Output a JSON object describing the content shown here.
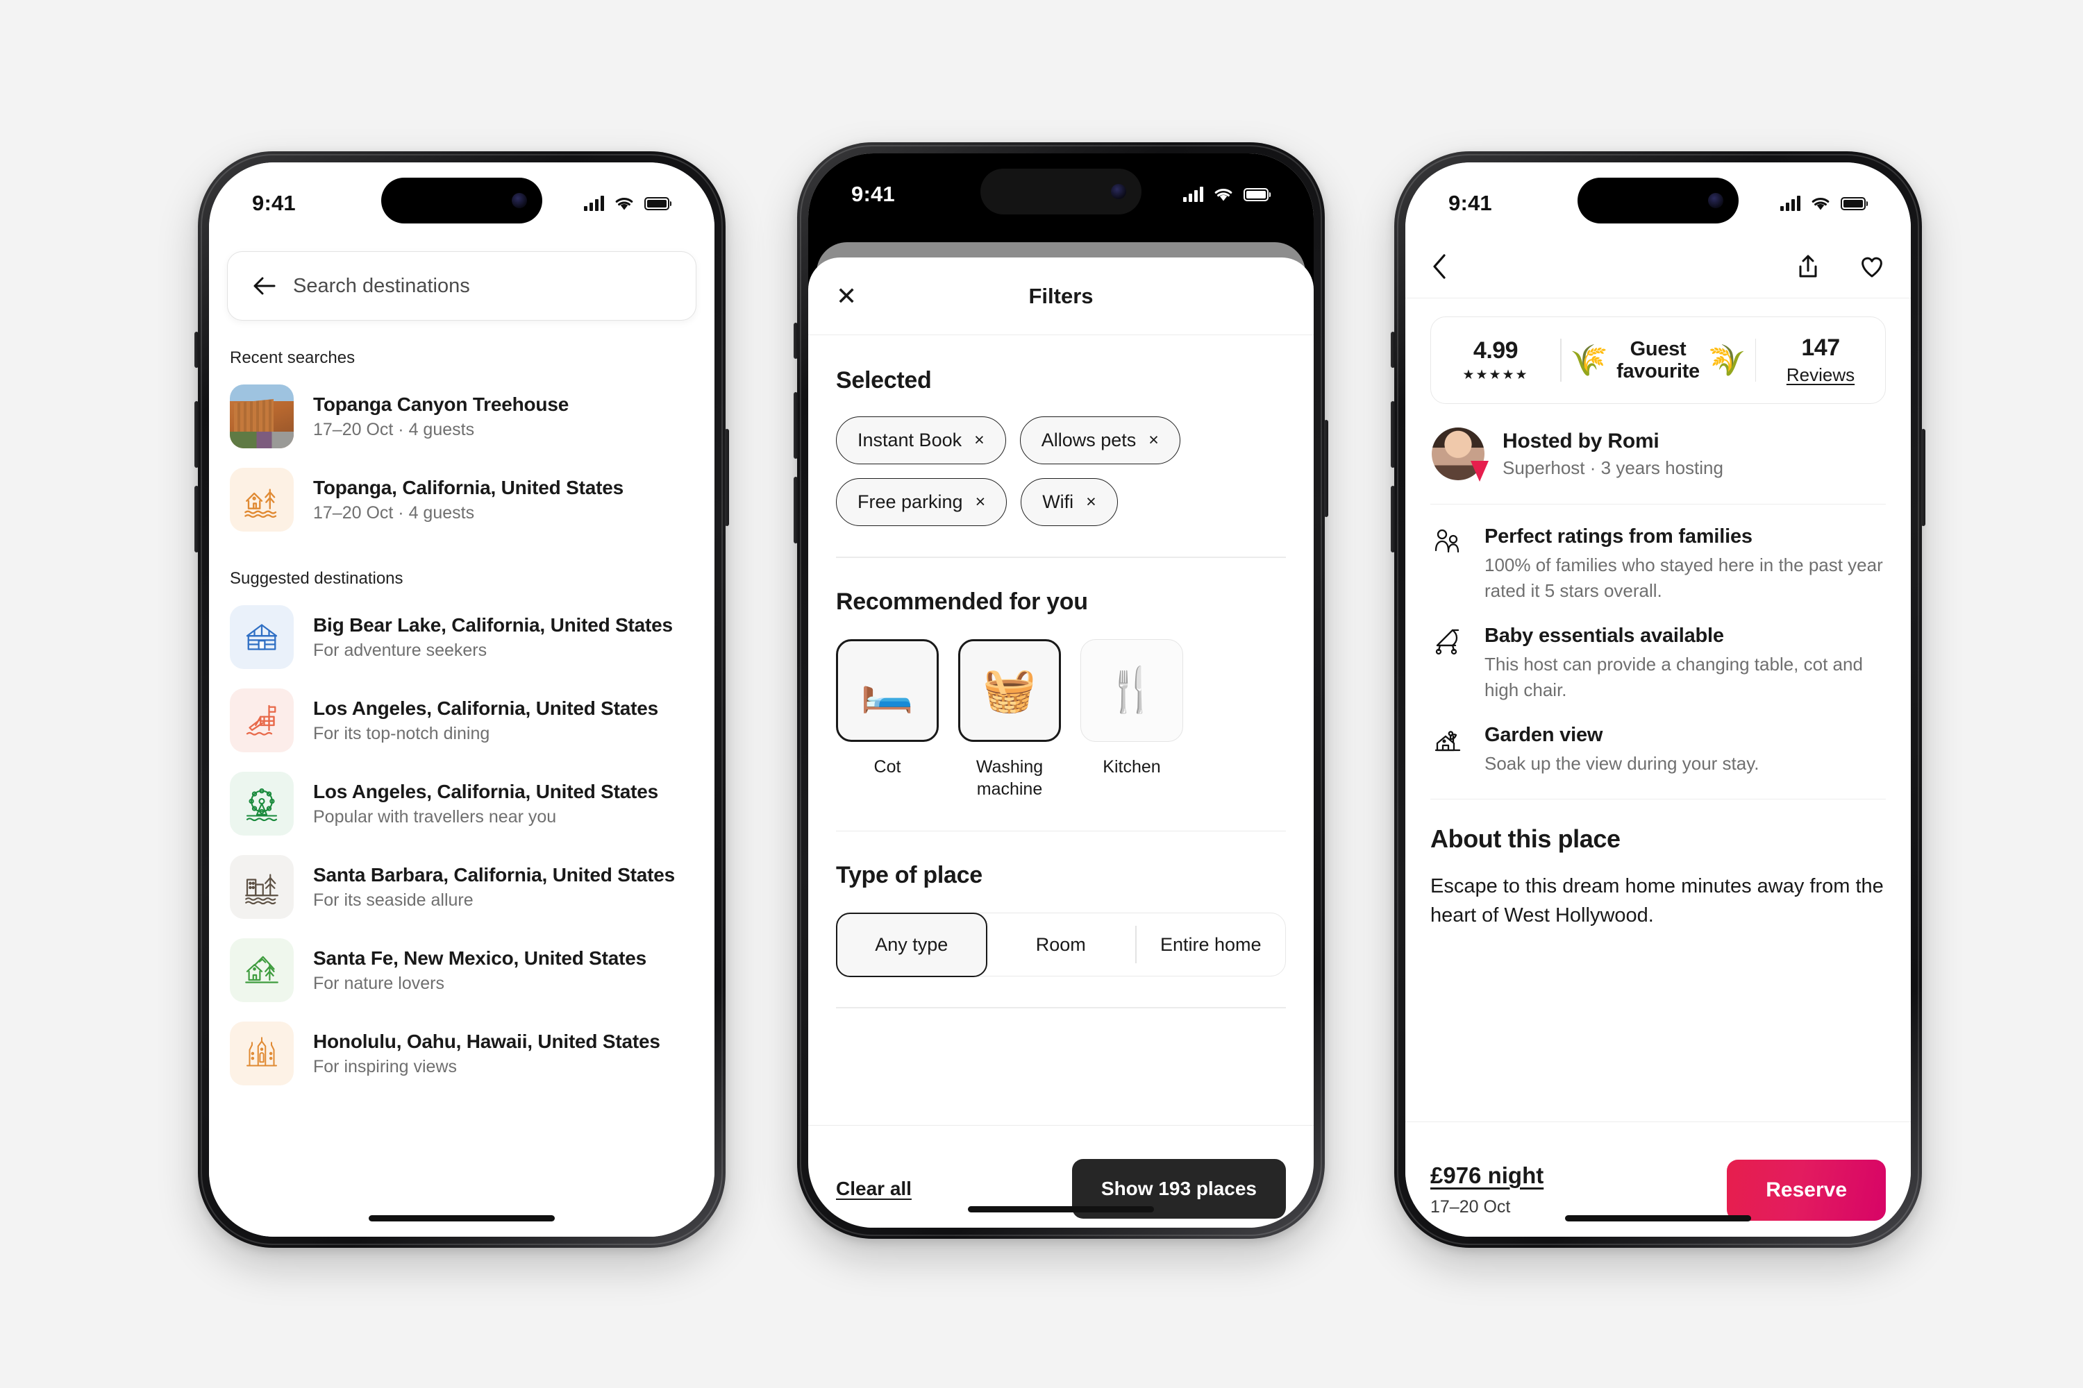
{
  "status_bar": {
    "time": "9:41"
  },
  "phone1": {
    "search": {
      "placeholder": "Search destinations"
    },
    "recent_label": "Recent searches",
    "recent": [
      {
        "title": "Topanga Canyon Treehouse",
        "subtitle": "17–20 Oct · 4 guests",
        "icon": "house-photo-thumbnail"
      },
      {
        "title": "Topanga, California, United States",
        "subtitle": "17–20 Oct · 4 guests",
        "icon": "cabin-lake-icon"
      }
    ],
    "suggested_label": "Suggested destinations",
    "suggested": [
      {
        "title": "Big Bear Lake, California, United States",
        "subtitle": "For adventure seekers",
        "icon": "log-cabin-icon",
        "color": "#2f6fc4",
        "bg": "#eaf1fa"
      },
      {
        "title": "Los Angeles, California, United States",
        "subtitle": "For its top-notch dining",
        "icon": "lifeguard-tower-icon",
        "color": "#e8694a",
        "bg": "#fcedea"
      },
      {
        "title": "Los Angeles, California, United States",
        "subtitle": "Popular with travellers near you",
        "icon": "ferris-wheel-icon",
        "color": "#1a8a3c",
        "bg": "#ecf6ef"
      },
      {
        "title": "Santa Barbara, California, United States",
        "subtitle": "For its seaside allure",
        "icon": "city-pier-icon",
        "color": "#5c5043",
        "bg": "#f3f2f0"
      },
      {
        "title": "Santa Fe, New Mexico, United States",
        "subtitle": "For nature lovers",
        "icon": "mountain-cabin-icon",
        "color": "#3e9c3e",
        "bg": "#eff7ed"
      },
      {
        "title": "Honolulu, Oahu, Hawaii, United States",
        "subtitle": "For inspiring views",
        "icon": "palace-icon",
        "color": "#e08a33",
        "bg": "#fdf2e6"
      }
    ]
  },
  "phone2": {
    "title": "Filters",
    "close_icon": "close-icon",
    "selected_label": "Selected",
    "selected_chips": [
      {
        "label": "Instant Book",
        "remove": "×"
      },
      {
        "label": "Allows pets",
        "remove": "×"
      },
      {
        "label": "Free parking",
        "remove": "×"
      },
      {
        "label": "Wifi",
        "remove": "×"
      }
    ],
    "recommended_label": "Recommended for you",
    "recommended": [
      {
        "label": "Cot",
        "emoji": "🛏️",
        "selected": true,
        "icon": "cot-icon"
      },
      {
        "label": "Washing machine",
        "emoji": "🧺",
        "selected": true,
        "icon": "washing-machine-icon"
      },
      {
        "label": "Kitchen",
        "emoji": "🍴",
        "selected": false,
        "icon": "kitchen-icon"
      }
    ],
    "type_of_place_label": "Type of place",
    "type_options": [
      {
        "label": "Any type",
        "active": true
      },
      {
        "label": "Room",
        "active": false
      },
      {
        "label": "Entire home",
        "active": false
      }
    ],
    "clear_all": "Clear all",
    "show_button": "Show 193 places"
  },
  "phone3": {
    "back_icon": "back-chevron-icon",
    "share_icon": "share-icon",
    "save_icon": "heart-icon",
    "rating": {
      "score": "4.99",
      "stars": "★★★★★"
    },
    "guest_favourite": "Guest\nfavourite",
    "guest_favourite_line1": "Guest",
    "guest_favourite_line2": "favourite",
    "reviews": {
      "count": "147",
      "label": "Reviews"
    },
    "host": {
      "name": "Hosted by Romi",
      "meta": "Superhost · 3 years hosting"
    },
    "features": [
      {
        "icon": "family-icon",
        "title": "Perfect ratings from families",
        "desc": "100% of families who stayed here in the past year rated it 5 stars overall."
      },
      {
        "icon": "stroller-icon",
        "title": "Baby essentials available",
        "desc": "This host can provide a changing table, cot and high chair."
      },
      {
        "icon": "garden-icon",
        "title": "Garden view",
        "desc": "Soak up the view during your stay."
      }
    ],
    "about_title": "About this place",
    "about_text": "Escape to this dream home minutes away from the heart of West Hollywood.",
    "booking": {
      "price": "£976 night",
      "dates": "17–20 Oct",
      "cta": "Reserve"
    }
  },
  "colors": {
    "brand": "#e31c5f",
    "dark": "#262626",
    "muted": "#6f6f6f"
  }
}
